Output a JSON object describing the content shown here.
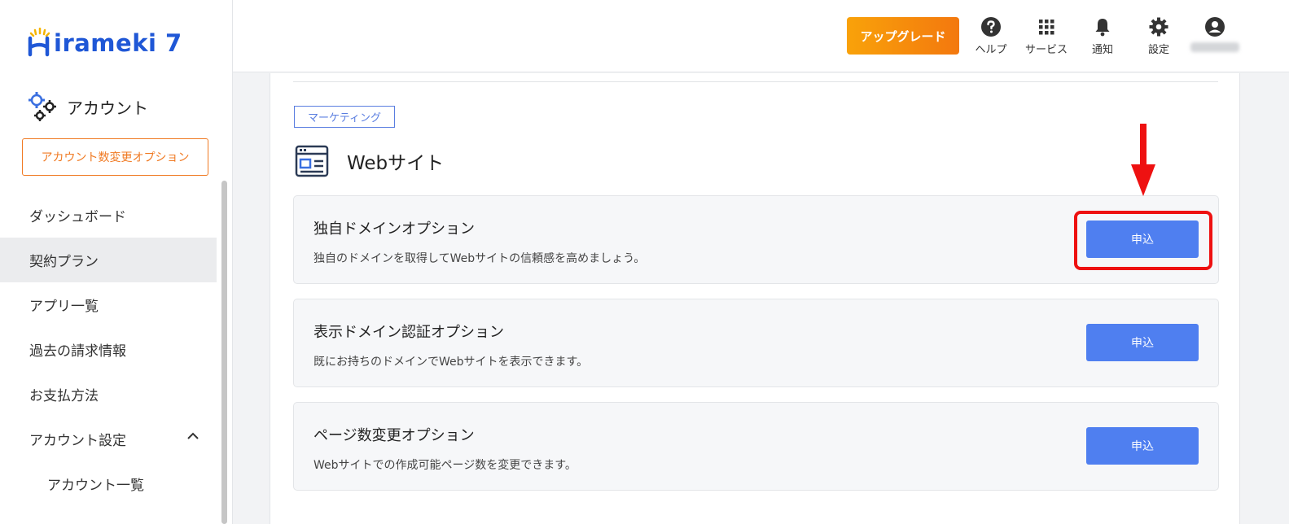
{
  "brand": {
    "logo_text": "irameki 7",
    "accent": "#1f57d6"
  },
  "sidebar": {
    "account_label": "アカウント",
    "option_button": "アカウント数変更オプション",
    "items": [
      {
        "label": "ダッシュボード"
      },
      {
        "label": "契約プラン",
        "active": true
      },
      {
        "label": "アプリ一覧"
      },
      {
        "label": "過去の請求情報"
      },
      {
        "label": "お支払方法"
      },
      {
        "label": "アカウント設定",
        "expanded": true
      },
      {
        "label": "アカウント一覧"
      }
    ]
  },
  "topbar": {
    "upgrade_label": "アップグレード",
    "icons": [
      {
        "icon": "help-icon",
        "label": "ヘルプ"
      },
      {
        "icon": "apps-grid-icon",
        "label": "サービス"
      },
      {
        "icon": "bell-icon",
        "label": "通知"
      },
      {
        "icon": "gear-icon",
        "label": "設定"
      },
      {
        "icon": "user-icon",
        "label": ""
      }
    ]
  },
  "main": {
    "category_tag": "マーケティング",
    "section_title": "Webサイト",
    "options": [
      {
        "name": "独自ドメインオプション",
        "description": "独自のドメインを取得してWebサイトの信頼感を高めましょう。",
        "button": "申込",
        "highlighted": true
      },
      {
        "name": "表示ドメイン認証オプション",
        "description": "既にお持ちのドメインでWebサイトを表示できます。",
        "button": "申込"
      },
      {
        "name": "ページ数変更オプション",
        "description": "Webサイトでの作成可能ページ数を変更できます。",
        "button": "申込"
      }
    ]
  },
  "colors": {
    "orange": "#f07a23",
    "button_blue": "#4f7ff0",
    "highlight_red": "#ee1111"
  }
}
